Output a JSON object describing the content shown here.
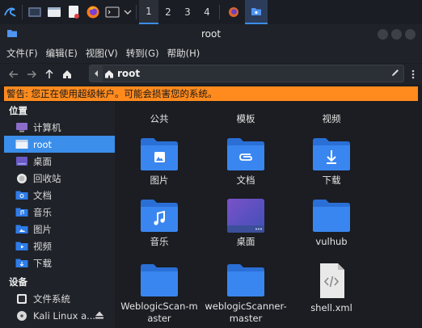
{
  "panel": {
    "workspaces": [
      "1",
      "2",
      "3",
      "4"
    ],
    "active_workspace": "1"
  },
  "window": {
    "title": "root"
  },
  "menu": {
    "items": [
      "文件(F)",
      "编辑(E)",
      "视图(V)",
      "转到(G)",
      "帮助(H)"
    ]
  },
  "location": {
    "crumb": "root"
  },
  "warning": {
    "text": "警告: 您正在使用超级帐户。可能会损害您的系统。"
  },
  "sidebar": {
    "places_heading": "位置",
    "places": [
      {
        "label": "计算机",
        "icon": "computer-icon"
      },
      {
        "label": "root",
        "icon": "home-folder-icon",
        "selected": true
      },
      {
        "label": "桌面",
        "icon": "desktop-icon"
      },
      {
        "label": "回收站",
        "icon": "trash-icon"
      },
      {
        "label": "文档",
        "icon": "documents-folder-icon"
      },
      {
        "label": "音乐",
        "icon": "music-folder-icon"
      },
      {
        "label": "图片",
        "icon": "pictures-folder-icon"
      },
      {
        "label": "视频",
        "icon": "videos-folder-icon"
      },
      {
        "label": "下载",
        "icon": "downloads-folder-icon"
      }
    ],
    "devices_heading": "设备",
    "devices": [
      {
        "label": "文件系统",
        "icon": "filesystem-icon"
      },
      {
        "label": "Kali Linux a...",
        "icon": "disc-icon"
      }
    ]
  },
  "files": {
    "top_labels": [
      "公共",
      "模板",
      "视频"
    ],
    "items": [
      {
        "label": "图片",
        "icon": "pictures-folder-icon"
      },
      {
        "label": "文档",
        "icon": "documents-folder-icon"
      },
      {
        "label": "下载",
        "icon": "downloads-folder-icon"
      },
      {
        "label": "音乐",
        "icon": "music-folder-icon"
      },
      {
        "label": "桌面",
        "icon": "desktop-folder-icon"
      },
      {
        "label": "vulhub",
        "icon": "folder-icon"
      },
      {
        "label": "WeblogicScan-master",
        "icon": "folder-icon"
      },
      {
        "label": "weblogicScanner-master",
        "icon": "folder-icon"
      },
      {
        "label": "shell.xml",
        "icon": "xml-file-icon"
      }
    ]
  },
  "colors": {
    "accent": "#3b8eea",
    "warning_bg": "#ff8a1d",
    "folder_blue": "#2f7ce8"
  }
}
